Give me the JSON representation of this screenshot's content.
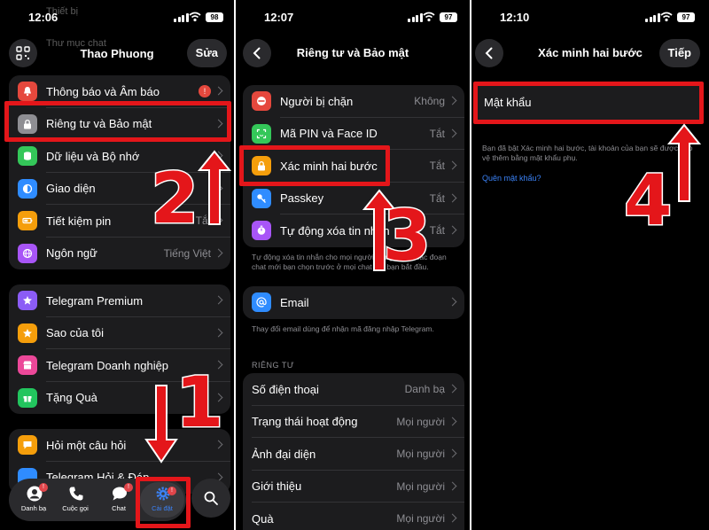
{
  "panel1": {
    "time": "12:06",
    "battery": "98",
    "profile_name": "Thao Phuong",
    "edit_label": "Sửa",
    "faded_items": [
      "Thiết bị",
      "Thư mục chat"
    ],
    "group1": [
      {
        "label": "Thông báo và Âm báo",
        "icon": "bell-icon",
        "color": "#e5483d",
        "value": "",
        "alert": "!"
      },
      {
        "label": "Riêng tư và Bảo mật",
        "icon": "lock-icon",
        "color": "#8e8e93",
        "value": ""
      },
      {
        "label": "Dữ liệu và Bộ nhớ",
        "icon": "database-icon",
        "color": "#34c759",
        "value": ""
      },
      {
        "label": "Giao diện",
        "icon": "half-circle-icon",
        "color": "#2f8cff",
        "value": ""
      },
      {
        "label": "Tiết kiệm pin",
        "icon": "battery-icon",
        "color": "#f59e0b",
        "value": "Tắt"
      },
      {
        "label": "Ngôn ngữ",
        "icon": "globe-icon",
        "color": "#a855f7",
        "value": "Tiếng Việt"
      }
    ],
    "group2": [
      {
        "label": "Telegram Premium",
        "icon": "star-icon",
        "color": "#8b5cf6"
      },
      {
        "label": "Sao của tôi",
        "icon": "star-icon",
        "color": "#f59e0b"
      },
      {
        "label": "Telegram Doanh nghiệp",
        "icon": "shop-icon",
        "color": "#ec4899"
      },
      {
        "label": "Tặng Quà",
        "icon": "gift-icon",
        "color": "#22c55e"
      }
    ],
    "group3": [
      {
        "label": "Hỏi một câu hỏi",
        "icon": "chat-icon",
        "color": "#f59e0b"
      },
      {
        "label": "Telegram Hỏi & Đáp",
        "icon": "question-icon",
        "color": "#2f8cff"
      }
    ],
    "tabs": [
      {
        "label": "Danh bạ",
        "icon": "person-icon",
        "badge": "!"
      },
      {
        "label": "Cuộc gọi",
        "icon": "phone-icon",
        "badge": ""
      },
      {
        "label": "Chat",
        "icon": "chat-bubble-icon",
        "badge": "!"
      },
      {
        "label": "Cài đặt",
        "icon": "gear-icon",
        "badge": "!"
      }
    ],
    "step1": "1",
    "step2": "2"
  },
  "panel2": {
    "time": "12:07",
    "battery": "97",
    "title": "Riêng tư và Bảo mật",
    "group1": [
      {
        "label": "Người bị chặn",
        "icon": "block-icon",
        "color": "#e5483d",
        "value": "Không"
      },
      {
        "label": "Mã PIN và Face ID",
        "icon": "face-id-icon",
        "color": "#34c759",
        "value": "Tắt"
      },
      {
        "label": "Xác minh hai bước",
        "icon": "lock-icon",
        "color": "#f59e0b",
        "value": "Tắt"
      },
      {
        "label": "Passkey",
        "icon": "key-icon",
        "color": "#2f8cff",
        "value": "Tắt"
      },
      {
        "label": "Tự động xóa tin nhắn",
        "icon": "timer-icon",
        "color": "#a855f7",
        "value": "Tắt"
      }
    ],
    "note1": "Tự động xóa tin nhắn cho mọi người trong tất cả các đoạn chat mới bạn chọn trước ở mọi chat mà bạn bắt đầu.",
    "email_label": "Email",
    "email_note": "Thay đổi email dùng để nhận mã đăng nhập Telegram.",
    "section_privacy": "RIÊNG TƯ",
    "group3": [
      {
        "label": "Số điện thoại",
        "value": "Danh bạ"
      },
      {
        "label": "Trạng thái hoạt động",
        "value": "Mọi người"
      },
      {
        "label": "Ảnh đại diện",
        "value": "Mọi người"
      },
      {
        "label": "Giới thiệu",
        "value": "Mọi người"
      },
      {
        "label": "Quà",
        "value": "Mọi người"
      }
    ],
    "step3": "3"
  },
  "panel3": {
    "time": "12:10",
    "battery": "97",
    "title": "Xác minh hai bước",
    "next_label": "Tiếp",
    "password_placeholder": "Mật khẩu",
    "note": "Bạn đã bật Xác minh hai bước, tài khoản của bạn sẽ được bảo vệ thêm bằng mật khẩu phụ.",
    "forgot_link": "Quên mật khẩu?",
    "step4": "4"
  }
}
